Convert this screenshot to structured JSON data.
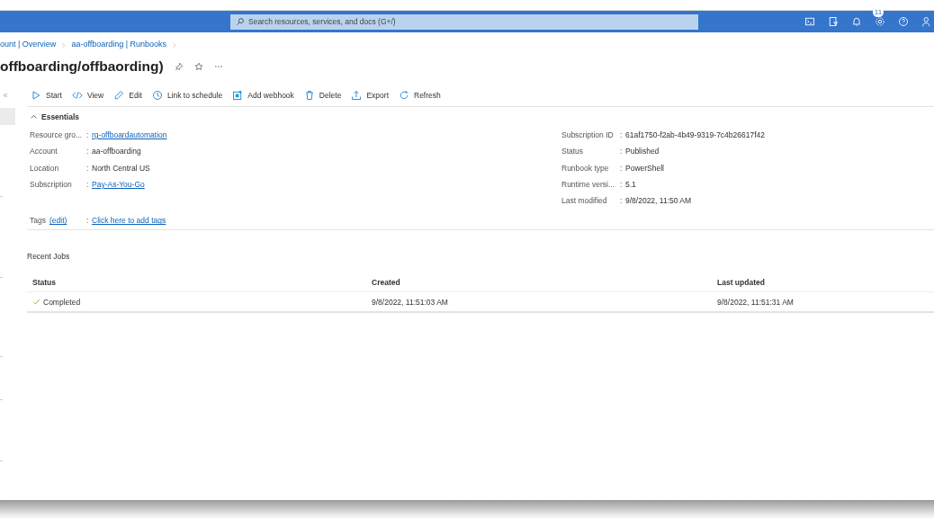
{
  "header": {
    "search": {
      "placeholder": "Search resources, services, and docs (G+/)"
    },
    "notifications_badge": "11"
  },
  "breadcrumb": [
    "ount | Overview",
    "aa-offboarding | Runbooks"
  ],
  "title": "offboarding/offbaording)",
  "sidebar": {
    "items": [
      {
        "selected": true
      }
    ]
  },
  "toolbar": [
    "Start",
    "View",
    "Edit",
    "Link to schedule",
    "Add webhook",
    "Delete",
    "Export",
    "Refresh"
  ],
  "essentials": {
    "title": "Essentials",
    "expanded": true,
    "separator": ":",
    "left": [
      {
        "label": "Resource gro...",
        "value": "rg-offboardautomation",
        "kind": "link"
      },
      {
        "label": "Account",
        "value": "aa-offboarding",
        "kind": "text"
      },
      {
        "label": "Location",
        "value": "North Central US",
        "kind": "text"
      },
      {
        "label": "Subscription",
        "value": "Pay-As-You-Go",
        "kind": "link"
      }
    ],
    "right": [
      {
        "label": "Subscription ID",
        "value": "61af1750-f2ab-4b49-9319-7c4b26617f42",
        "kind": "text"
      },
      {
        "label": "Status",
        "value": "Published",
        "kind": "text"
      },
      {
        "label": "Runbook type",
        "value": "PowerShell",
        "kind": "text"
      },
      {
        "label": "Runtime versi...",
        "value": "5.1",
        "kind": "text"
      },
      {
        "label": "Last modified",
        "value": "9/8/2022, 11:50 AM",
        "kind": "text"
      }
    ],
    "tags": {
      "label": "Tags",
      "edit": "(edit)",
      "value": "Click here to add tags"
    }
  },
  "recent_jobs": {
    "title": "Recent Jobs",
    "columns": [
      "Status",
      "Created",
      "Last updated"
    ],
    "rows": [
      {
        "status": "Completed",
        "created": "9/8/2022, 11:51:03 AM",
        "last_updated": "9/8/2022, 11:51:31 AM"
      }
    ]
  }
}
